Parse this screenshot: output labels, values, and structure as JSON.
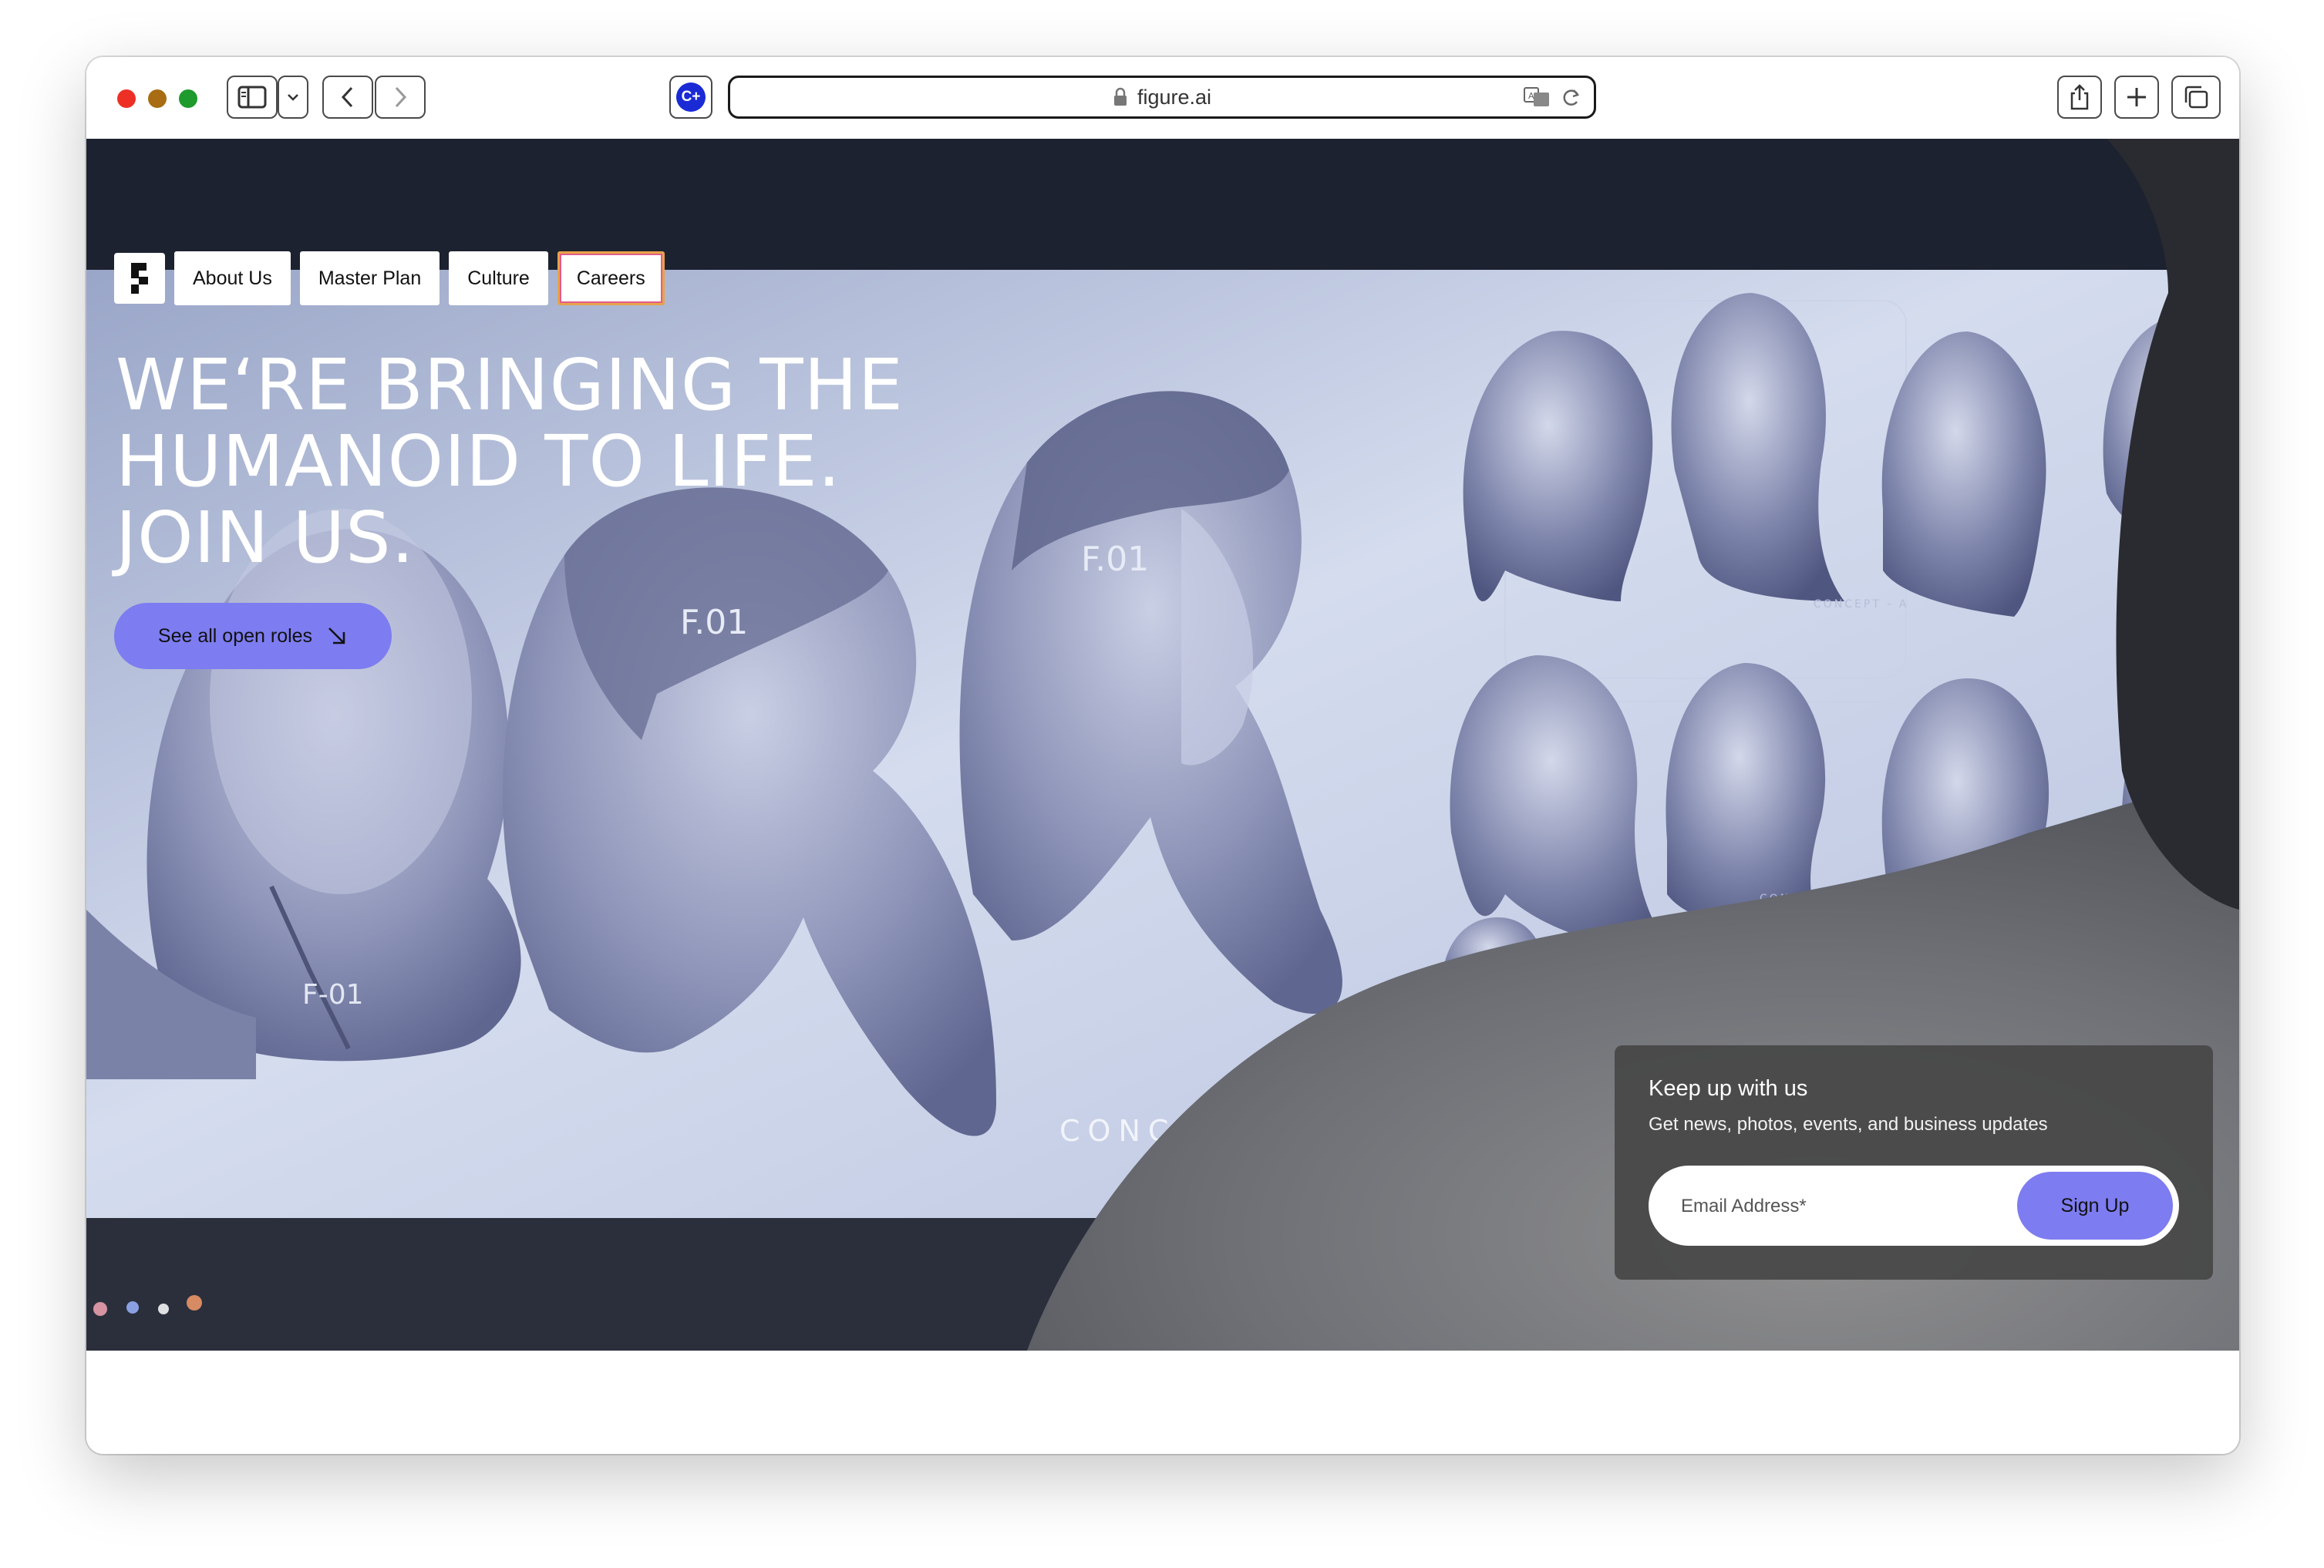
{
  "browser": {
    "url": "figure.ai",
    "extension_label": "C+"
  },
  "nav": {
    "items": [
      {
        "label": "About Us"
      },
      {
        "label": "Master Plan"
      },
      {
        "label": "Culture"
      },
      {
        "label": "Careers"
      }
    ]
  },
  "hero": {
    "headline_lines": [
      "WE‘RE BRINGING THE",
      "HUMANOID TO LIFE.",
      "JOIN US."
    ],
    "cta_label": "See all open roles",
    "image_texts": [
      "F.01",
      "F.01",
      "F-01",
      "CONCEPT",
      "CONCEPT - A",
      "CONCEPT - B"
    ]
  },
  "newsletter": {
    "title": "Keep up with us",
    "subtitle": "Get news, photos, events, and business updates",
    "email_placeholder": "Email Address*",
    "button_label": "Sign Up"
  },
  "colors": {
    "accent": "#7d7cf0",
    "newsletter_bg": "#464646",
    "active_nav_border": "#e8a34a"
  }
}
